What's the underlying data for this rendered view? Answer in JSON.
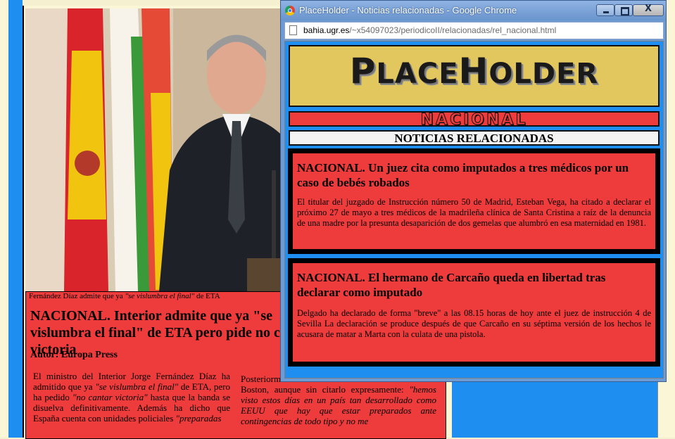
{
  "background": {
    "caption_start": "Fernández Díaz admite que ya ",
    "caption_quote": "\"se vislumbra el final\"",
    "caption_end": " de ETA",
    "headline": "NACIONAL. Interior admite que ya \"se vislumbra el final\" de ETA pero pide no cantar victoria",
    "author": "Autor: Europa Press",
    "col1_a": "El ministro del Interior Jorge Fernández Díaz ha admitido que ya ",
    "col1_q1": "\"se vislumbra el final\"",
    "col1_b": " de ETA, pero ha pedido ",
    "col1_q2": "\"no cantar victoria\"",
    "col1_c": " hasta que la banda se disuelva definitivamente. Además ha dicho que España cuenta con unidades policiales ",
    "col1_q3": "\"preparadas",
    "col2_a": "Posteriormente ha hecho referencia al atentado de Boston, aunque sin citarlo expresamente: ",
    "col2_q": "\"hemos visto estos días en un país tan desarrollado como EEUU que hay que estar preparados ante contingencias de todo tipo y no me"
  },
  "popup": {
    "window_title": "PlaceHolder - Noticias relacionadas - Google Chrome",
    "url_host": "bahia.ugr.es",
    "url_path": "/~x54097023/periodicoII/relacionadas/rel_nacional.html",
    "close_glyph": "X",
    "logo_text_1": "P",
    "logo_text_2": "LACE",
    "logo_text_3": "H",
    "logo_text_4": "OLDER",
    "section_label": "NACIONAL",
    "related_heading": "NOTICIAS RELACIONADAS",
    "news": [
      {
        "title": "NACIONAL. Un juez cita como imputados a tres médicos por un caso de bebés robados",
        "body": "El titular del juzgado de Instrucción número 50 de Madrid, Esteban Vega, ha citado a declarar el próximo 27 de mayo a tres médicos de la madrileña clínica de Santa Cristina a raíz de la denuncia de una madre por la presunta desaparición de dos gemelas que alumbró en esa maternidad en 1981."
      },
      {
        "title": "NACIONAL. El hermano de Carcaño queda en libertad tras declarar como imputado",
        "body": "Delgado ha declarado de forma \"breve\" a las 08.15 horas de hoy ante el juez de instrucción 4 de Sevilla La declaración se produce después de que Carcaño en su séptima versión de los hechos le acusara de matar a Marta con la culata de una pistola."
      }
    ]
  }
}
